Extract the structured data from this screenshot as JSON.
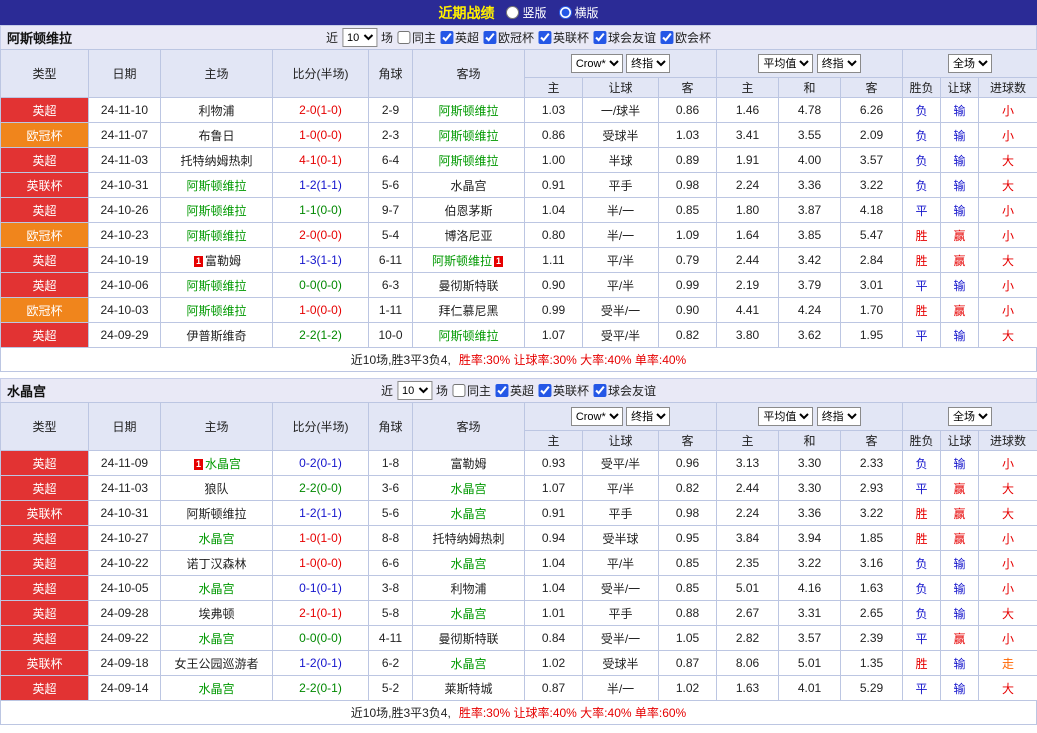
{
  "topbar": {
    "title": "近期战绩",
    "radios": [
      {
        "name": "vertical",
        "label": "竖版",
        "checked": false
      },
      {
        "name": "horizontal",
        "label": "横版",
        "checked": true
      }
    ]
  },
  "filter_labels": {
    "near": "近",
    "games": "场"
  },
  "headers": {
    "type": "类型",
    "date": "日期",
    "home": "主场",
    "score": "比分(半场)",
    "corner": "角球",
    "away": "客场",
    "sub": [
      "主",
      "让球",
      "客",
      "主",
      "和",
      "客",
      "胜负",
      "让球",
      "进球数"
    ]
  },
  "selects": {
    "bookmaker": "Crow*",
    "final": "终指",
    "average": "平均值",
    "fulltime": "全场"
  },
  "colors": {
    "topbar_bg": "#2b2b96",
    "band_bg": "#e9e9f6",
    "header_bg": "#e2e6f5",
    "border": "#bcc6e2",
    "title_yellow": "#ffef00",
    "team_green": "#009900",
    "type_bg": {
      "red": "#e23333",
      "orange": "#f0851c"
    },
    "state": {
      "red": "#e60000",
      "blue": "#1414cc",
      "green": "#008800",
      "orange": "#ff6600"
    }
  },
  "sections": [
    {
      "team": "阿斯顿维拉",
      "filter_count": "10",
      "checkboxes": [
        {
          "label": "同主",
          "checked": false
        },
        {
          "label": "英超",
          "checked": true
        },
        {
          "label": "欧冠杯",
          "checked": true
        },
        {
          "label": "英联杯",
          "checked": true
        },
        {
          "label": "球会友谊",
          "checked": true
        },
        {
          "label": "欧会杯",
          "checked": true
        }
      ],
      "rows": [
        {
          "type": "英超",
          "type_color": "red",
          "date": "24-11-10",
          "home": {
            "name": "利物浦",
            "green": false
          },
          "score": "2-0(1-0)",
          "score_color": "red",
          "corner": "2-9",
          "away": {
            "name": "阿斯顿维拉",
            "green": true
          },
          "h": "1.03",
          "line": "一/球半",
          "a": "0.86",
          "avg_h": "1.46",
          "avg_d": "4.78",
          "avg_a": "6.26",
          "result": "负",
          "result_color": "blue",
          "asian": "输",
          "asian_color": "blue",
          "goals": "小",
          "goals_color": "red"
        },
        {
          "type": "欧冠杯",
          "type_color": "orange",
          "date": "24-11-07",
          "home": {
            "name": "布鲁日",
            "green": false
          },
          "score": "1-0(0-0)",
          "score_color": "red",
          "corner": "2-3",
          "away": {
            "name": "阿斯顿维拉",
            "green": true
          },
          "h": "0.86",
          "line": "受球半",
          "a": "1.03",
          "avg_h": "3.41",
          "avg_d": "3.55",
          "avg_a": "2.09",
          "result": "负",
          "result_color": "blue",
          "asian": "输",
          "asian_color": "blue",
          "goals": "小",
          "goals_color": "red"
        },
        {
          "type": "英超",
          "type_color": "red",
          "date": "24-11-03",
          "home": {
            "name": "托特纳姆热刺",
            "green": false
          },
          "score": "4-1(0-1)",
          "score_color": "red",
          "corner": "6-4",
          "away": {
            "name": "阿斯顿维拉",
            "green": true
          },
          "h": "1.00",
          "line": "半球",
          "a": "0.89",
          "avg_h": "1.91",
          "avg_d": "4.00",
          "avg_a": "3.57",
          "result": "负",
          "result_color": "blue",
          "asian": "输",
          "asian_color": "blue",
          "goals": "大",
          "goals_color": "red"
        },
        {
          "type": "英联杯",
          "type_color": "red",
          "date": "24-10-31",
          "home": {
            "name": "阿斯顿维拉",
            "green": true
          },
          "score": "1-2(1-1)",
          "score_color": "blue",
          "corner": "5-6",
          "away": {
            "name": "水晶宫",
            "green": false
          },
          "h": "0.91",
          "line": "平手",
          "a": "0.98",
          "avg_h": "2.24",
          "avg_d": "3.36",
          "avg_a": "3.22",
          "result": "负",
          "result_color": "blue",
          "asian": "输",
          "asian_color": "blue",
          "goals": "大",
          "goals_color": "red"
        },
        {
          "type": "英超",
          "type_color": "red",
          "date": "24-10-26",
          "home": {
            "name": "阿斯顿维拉",
            "green": true
          },
          "score": "1-1(0-0)",
          "score_color": "green",
          "corner": "9-7",
          "away": {
            "name": "伯恩茅斯",
            "green": false
          },
          "h": "1.04",
          "line": "半/一",
          "a": "0.85",
          "avg_h": "1.80",
          "avg_d": "3.87",
          "avg_a": "4.18",
          "result": "平",
          "result_color": "blue",
          "asian": "输",
          "asian_color": "blue",
          "goals": "小",
          "goals_color": "red"
        },
        {
          "type": "欧冠杯",
          "type_color": "orange",
          "date": "24-10-23",
          "home": {
            "name": "阿斯顿维拉",
            "green": true
          },
          "score": "2-0(0-0)",
          "score_color": "red",
          "corner": "5-4",
          "away": {
            "name": "博洛尼亚",
            "green": false
          },
          "h": "0.80",
          "line": "半/一",
          "a": "1.09",
          "avg_h": "1.64",
          "avg_d": "3.85",
          "avg_a": "5.47",
          "result": "胜",
          "result_color": "red",
          "asian": "赢",
          "asian_color": "red",
          "goals": "小",
          "goals_color": "red"
        },
        {
          "type": "英超",
          "type_color": "red",
          "date": "24-10-19",
          "home": {
            "name": "富勒姆",
            "green": false,
            "pre": "1"
          },
          "score": "1-3(1-1)",
          "score_color": "blue",
          "corner": "6-11",
          "away": {
            "name": "阿斯顿维拉",
            "green": true,
            "post": "1"
          },
          "h": "1.11",
          "line": "平/半",
          "a": "0.79",
          "avg_h": "2.44",
          "avg_d": "3.42",
          "avg_a": "2.84",
          "result": "胜",
          "result_color": "red",
          "asian": "赢",
          "asian_color": "red",
          "goals": "大",
          "goals_color": "red"
        },
        {
          "type": "英超",
          "type_color": "red",
          "date": "24-10-06",
          "home": {
            "name": "阿斯顿维拉",
            "green": true
          },
          "score": "0-0(0-0)",
          "score_color": "green",
          "corner": "6-3",
          "away": {
            "name": "曼彻斯特联",
            "green": false
          },
          "h": "0.90",
          "line": "平/半",
          "a": "0.99",
          "avg_h": "2.19",
          "avg_d": "3.79",
          "avg_a": "3.01",
          "result": "平",
          "result_color": "blue",
          "asian": "输",
          "asian_color": "blue",
          "goals": "小",
          "goals_color": "red"
        },
        {
          "type": "欧冠杯",
          "type_color": "orange",
          "date": "24-10-03",
          "home": {
            "name": "阿斯顿维拉",
            "green": true
          },
          "score": "1-0(0-0)",
          "score_color": "red",
          "corner": "1-11",
          "away": {
            "name": "拜仁慕尼黑",
            "green": false
          },
          "h": "0.99",
          "line": "受半/一",
          "a": "0.90",
          "avg_h": "4.41",
          "avg_d": "4.24",
          "avg_a": "1.70",
          "result": "胜",
          "result_color": "red",
          "asian": "赢",
          "asian_color": "red",
          "goals": "小",
          "goals_color": "red"
        },
        {
          "type": "英超",
          "type_color": "red",
          "date": "24-09-29",
          "home": {
            "name": "伊普斯维奇",
            "green": false
          },
          "score": "2-2(1-2)",
          "score_color": "green",
          "corner": "10-0",
          "away": {
            "name": "阿斯顿维拉",
            "green": true
          },
          "h": "1.07",
          "line": "受平/半",
          "a": "0.82",
          "avg_h": "3.80",
          "avg_d": "3.62",
          "avg_a": "1.95",
          "result": "平",
          "result_color": "blue",
          "asian": "输",
          "asian_color": "blue",
          "goals": "大",
          "goals_color": "red"
        }
      ],
      "summary_plain": "近10场,胜3平3负4,",
      "summary_stats": "胜率:30% 让球率:30% 大率:40% 单率:40%"
    },
    {
      "team": "水晶宫",
      "filter_count": "10",
      "checkboxes": [
        {
          "label": "同主",
          "checked": false
        },
        {
          "label": "英超",
          "checked": true
        },
        {
          "label": "英联杯",
          "checked": true
        },
        {
          "label": "球会友谊",
          "checked": true
        }
      ],
      "rows": [
        {
          "type": "英超",
          "type_color": "red",
          "date": "24-11-09",
          "home": {
            "name": "水晶宫",
            "green": true,
            "pre": "1"
          },
          "score": "0-2(0-1)",
          "score_color": "blue",
          "corner": "1-8",
          "away": {
            "name": "富勒姆",
            "green": false
          },
          "h": "0.93",
          "line": "受平/半",
          "a": "0.96",
          "avg_h": "3.13",
          "avg_d": "3.30",
          "avg_a": "2.33",
          "result": "负",
          "result_color": "blue",
          "asian": "输",
          "asian_color": "blue",
          "goals": "小",
          "goals_color": "red"
        },
        {
          "type": "英超",
          "type_color": "red",
          "date": "24-11-03",
          "home": {
            "name": "狼队",
            "green": false
          },
          "score": "2-2(0-0)",
          "score_color": "green",
          "corner": "3-6",
          "away": {
            "name": "水晶宫",
            "green": true
          },
          "h": "1.07",
          "line": "平/半",
          "a": "0.82",
          "avg_h": "2.44",
          "avg_d": "3.30",
          "avg_a": "2.93",
          "result": "平",
          "result_color": "blue",
          "asian": "赢",
          "asian_color": "red",
          "goals": "大",
          "goals_color": "red"
        },
        {
          "type": "英联杯",
          "type_color": "red",
          "date": "24-10-31",
          "home": {
            "name": "阿斯顿维拉",
            "green": false
          },
          "score": "1-2(1-1)",
          "score_color": "blue",
          "corner": "5-6",
          "away": {
            "name": "水晶宫",
            "green": true
          },
          "h": "0.91",
          "line": "平手",
          "a": "0.98",
          "avg_h": "2.24",
          "avg_d": "3.36",
          "avg_a": "3.22",
          "result": "胜",
          "result_color": "red",
          "asian": "赢",
          "asian_color": "red",
          "goals": "大",
          "goals_color": "red"
        },
        {
          "type": "英超",
          "type_color": "red",
          "date": "24-10-27",
          "home": {
            "name": "水晶宫",
            "green": true
          },
          "score": "1-0(1-0)",
          "score_color": "red",
          "corner": "8-8",
          "away": {
            "name": "托特纳姆热刺",
            "green": false
          },
          "h": "0.94",
          "line": "受半球",
          "a": "0.95",
          "avg_h": "3.84",
          "avg_d": "3.94",
          "avg_a": "1.85",
          "result": "胜",
          "result_color": "red",
          "asian": "赢",
          "asian_color": "red",
          "goals": "小",
          "goals_color": "red"
        },
        {
          "type": "英超",
          "type_color": "red",
          "date": "24-10-22",
          "home": {
            "name": "诺丁汉森林",
            "green": false
          },
          "score": "1-0(0-0)",
          "score_color": "red",
          "corner": "6-6",
          "away": {
            "name": "水晶宫",
            "green": true
          },
          "h": "1.04",
          "line": "平/半",
          "a": "0.85",
          "avg_h": "2.35",
          "avg_d": "3.22",
          "avg_a": "3.16",
          "result": "负",
          "result_color": "blue",
          "asian": "输",
          "asian_color": "blue",
          "goals": "小",
          "goals_color": "red"
        },
        {
          "type": "英超",
          "type_color": "red",
          "date": "24-10-05",
          "home": {
            "name": "水晶宫",
            "green": true
          },
          "score": "0-1(0-1)",
          "score_color": "blue",
          "corner": "3-8",
          "away": {
            "name": "利物浦",
            "green": false
          },
          "h": "1.04",
          "line": "受半/一",
          "a": "0.85",
          "avg_h": "5.01",
          "avg_d": "4.16",
          "avg_a": "1.63",
          "result": "负",
          "result_color": "blue",
          "asian": "输",
          "asian_color": "blue",
          "goals": "小",
          "goals_color": "red"
        },
        {
          "type": "英超",
          "type_color": "red",
          "date": "24-09-28",
          "home": {
            "name": "埃弗顿",
            "green": false
          },
          "score": "2-1(0-1)",
          "score_color": "red",
          "corner": "5-8",
          "away": {
            "name": "水晶宫",
            "green": true
          },
          "h": "1.01",
          "line": "平手",
          "a": "0.88",
          "avg_h": "2.67",
          "avg_d": "3.31",
          "avg_a": "2.65",
          "result": "负",
          "result_color": "blue",
          "asian": "输",
          "asian_color": "blue",
          "goals": "大",
          "goals_color": "red"
        },
        {
          "type": "英超",
          "type_color": "red",
          "date": "24-09-22",
          "home": {
            "name": "水晶宫",
            "green": true
          },
          "score": "0-0(0-0)",
          "score_color": "green",
          "corner": "4-11",
          "away": {
            "name": "曼彻斯特联",
            "green": false
          },
          "h": "0.84",
          "line": "受半/一",
          "a": "1.05",
          "avg_h": "2.82",
          "avg_d": "3.57",
          "avg_a": "2.39",
          "result": "平",
          "result_color": "blue",
          "asian": "赢",
          "asian_color": "red",
          "goals": "小",
          "goals_color": "red"
        },
        {
          "type": "英联杯",
          "type_color": "red",
          "date": "24-09-18",
          "home": {
            "name": "女王公园巡游者",
            "green": false
          },
          "score": "1-2(0-1)",
          "score_color": "blue",
          "corner": "6-2",
          "away": {
            "name": "水晶宫",
            "green": true
          },
          "h": "1.02",
          "line": "受球半",
          "a": "0.87",
          "avg_h": "8.06",
          "avg_d": "5.01",
          "avg_a": "1.35",
          "result": "胜",
          "result_color": "red",
          "asian": "输",
          "asian_color": "blue",
          "goals": "走",
          "goals_color": "orange"
        },
        {
          "type": "英超",
          "type_color": "red",
          "date": "24-09-14",
          "home": {
            "name": "水晶宫",
            "green": true
          },
          "score": "2-2(0-1)",
          "score_color": "green",
          "corner": "5-2",
          "away": {
            "name": "莱斯特城",
            "green": false
          },
          "h": "0.87",
          "line": "半/一",
          "a": "1.02",
          "avg_h": "1.63",
          "avg_d": "4.01",
          "avg_a": "5.29",
          "result": "平",
          "result_color": "blue",
          "asian": "输",
          "asian_color": "blue",
          "goals": "大",
          "goals_color": "red"
        }
      ],
      "summary_plain": "近10场,胜3平3负4,",
      "summary_stats": "胜率:30% 让球率:40% 大率:40% 单率:60%"
    }
  ]
}
